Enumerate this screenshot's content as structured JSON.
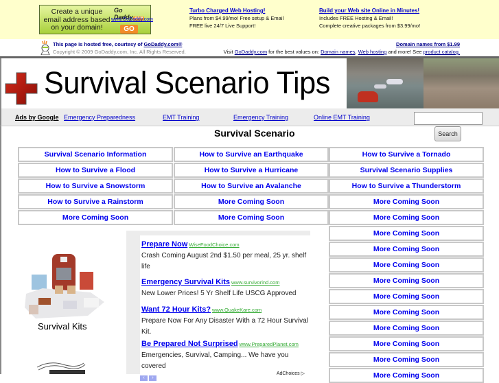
{
  "godaddy_banner": {
    "ad_text": "Create a unique email address based on your domain!",
    "ad_logo": "Go Daddy",
    "ad_logo_suffix": ".com",
    "ad_url": "www.GoDaddy.com",
    "ad_button": "GO",
    "promo1": {
      "headline": "Turbo Charged Web Hosting!",
      "line1": "Plans from $4.99/mo! Free setup & Email",
      "line2": "FREE live 24/7 Live Support!"
    },
    "promo2": {
      "headline": "Build your Web site Online in Minutes!",
      "line1": "Includes FREE Hosting & Email!",
      "line2": "Complete creative packages from $3.99/mo!"
    },
    "hosted_text": "This page is hosted free, courtesy of ",
    "hosted_link": "GoDaddy.com®",
    "copyright": "Copyright © 2009 GoDaddy.com, Inc. All Rights Reserved.",
    "domain_link": "Domain names from $1.99",
    "visit_prefix": "Visit ",
    "visit_link": "GoDaddy.com",
    "visit_middle": " for the best values on: ",
    "visit_link2": "Domain names",
    "visit_sep": ", ",
    "visit_link3": "Web hosting",
    "visit_middle2": " and more! See ",
    "visit_link4": "product catalog."
  },
  "header": {
    "site_title": "Survival Scenario Tips"
  },
  "adbar": {
    "label": "Ads by Google",
    "links": [
      "Emergency Preparedness",
      "EMT Training",
      "Emergency Training",
      "Online EMT Training"
    ]
  },
  "search": {
    "value": "",
    "button_label": "Search"
  },
  "main": {
    "title": "Survival Scenario",
    "grid": {
      "col1": [
        "Survival Scenario Information",
        "How to Survive a Flood",
        "How to Survive a Snowstorm",
        "How to Survive a Rainstorm",
        "More Coming Soon"
      ],
      "col2": [
        "How to Survive an Earthquake",
        "How to Survive a Hurricane",
        "How to Survive an Avalanche",
        "More Coming Soon",
        "More Coming Soon"
      ],
      "col3": [
        "How to Survive a Tornado",
        "Survival Scenario Supplies",
        "How to Survive a Thunderstorm",
        "More Coming Soon",
        "More Coming Soon",
        "More Coming Soon",
        "More Coming Soon",
        "More Coming Soon",
        "More Coming Soon",
        "More Coming Soon",
        "More Coming Soon",
        "More Coming Soon",
        "More Coming Soon",
        "More Coming Soon",
        "More Coming Soon"
      ]
    },
    "kit_caption": "Survival Kits"
  },
  "adsense": {
    "ads": [
      {
        "title": "Prepare Now",
        "url": "WiseFoodChoice.com",
        "body": "Crash Coming August 2nd $1.50 per meal, 25 yr. shelf life"
      },
      {
        "title": "Emergency Survival Kits",
        "url": "www.survivorind.com",
        "body": "New Lower Prices! 5 Yr Shelf Life USCG Approved"
      },
      {
        "title": "Want 72 Hour Kits?",
        "url": "www.QuakeKare.com",
        "body": "Prepare Now For Any Disaster With a 72 Hour Survival Kit."
      },
      {
        "title": "Be Prepared Not Surprised",
        "url": "www.PreparedPlanet.com",
        "body": "Emergencies, Survival, Camping... We have you covered"
      }
    ],
    "prev_arrow": "‹",
    "next_arrow": "›",
    "adchoices": "AdChoices ▷"
  }
}
